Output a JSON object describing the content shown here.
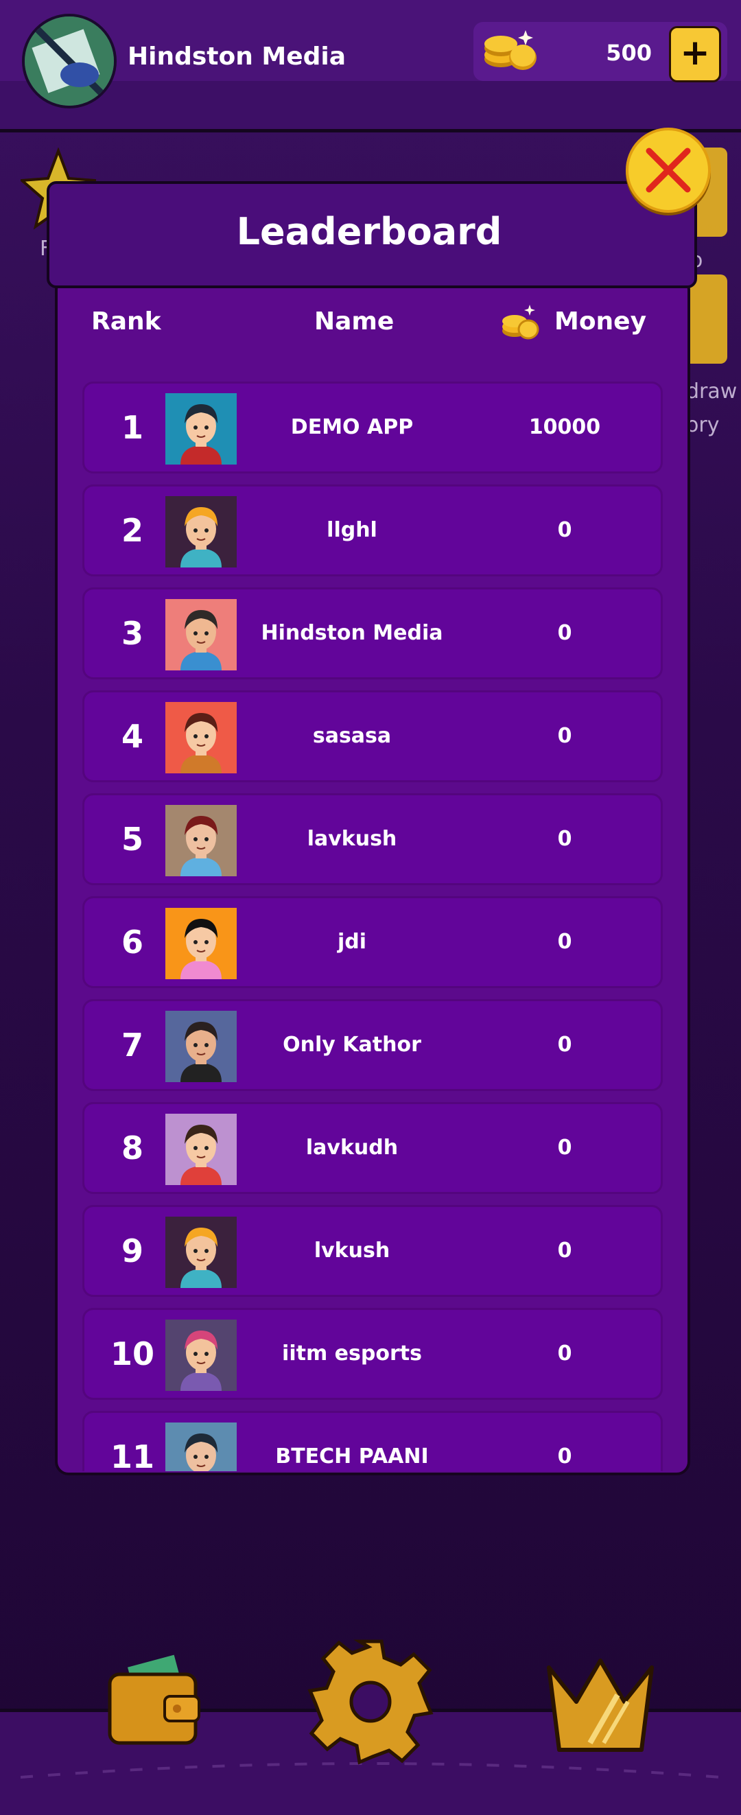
{
  "header": {
    "username": "Hindston Media",
    "coins": "500",
    "add_label": "+"
  },
  "background": {
    "left_label": "F",
    "right_label_1": "o",
    "right_label_2": "draw",
    "right_label_3": "ory"
  },
  "leaderboard": {
    "title": "Leaderboard",
    "columns": {
      "rank": "Rank",
      "name": "Name",
      "money": "Money"
    },
    "rows": [
      {
        "rank": "1",
        "name": "DEMO APP",
        "money": "10000",
        "avatar_bg": "#1f8fb4"
      },
      {
        "rank": "2",
        "name": "llghl",
        "money": "0",
        "avatar_bg": "#3b213d"
      },
      {
        "rank": "3",
        "name": "Hindston Media",
        "money": "0",
        "avatar_bg": "#ee7e7a"
      },
      {
        "rank": "4",
        "name": "sasasa",
        "money": "0",
        "avatar_bg": "#ef5a47"
      },
      {
        "rank": "5",
        "name": "lavkush",
        "money": "0",
        "avatar_bg": "#a4876e"
      },
      {
        "rank": "6",
        "name": "jdi",
        "money": "0",
        "avatar_bg": "#f99518"
      },
      {
        "rank": "7",
        "name": "Only Kathor",
        "money": "0",
        "avatar_bg": "#56679c"
      },
      {
        "rank": "8",
        "name": "lavkudh",
        "money": "0",
        "avatar_bg": "#bd91d0"
      },
      {
        "rank": "9",
        "name": "lvkush",
        "money": "0",
        "avatar_bg": "#3b213d"
      },
      {
        "rank": "10",
        "name": "iitm esports",
        "money": "0",
        "avatar_bg": "#54446f"
      },
      {
        "rank": "11",
        "name": "BTECH PAANI",
        "money": "0",
        "avatar_bg": "#5d8cb0"
      }
    ]
  },
  "colors": {
    "accent_yellow": "#f7c834",
    "modal_purple": "#5c0a8c",
    "row_purple": "#62059a"
  },
  "icons": {
    "coins": "gold-coins-icon",
    "close": "close-icon",
    "wallet": "wallet-icon",
    "settings": "gear-icon",
    "leaderboard": "crown-icon"
  }
}
